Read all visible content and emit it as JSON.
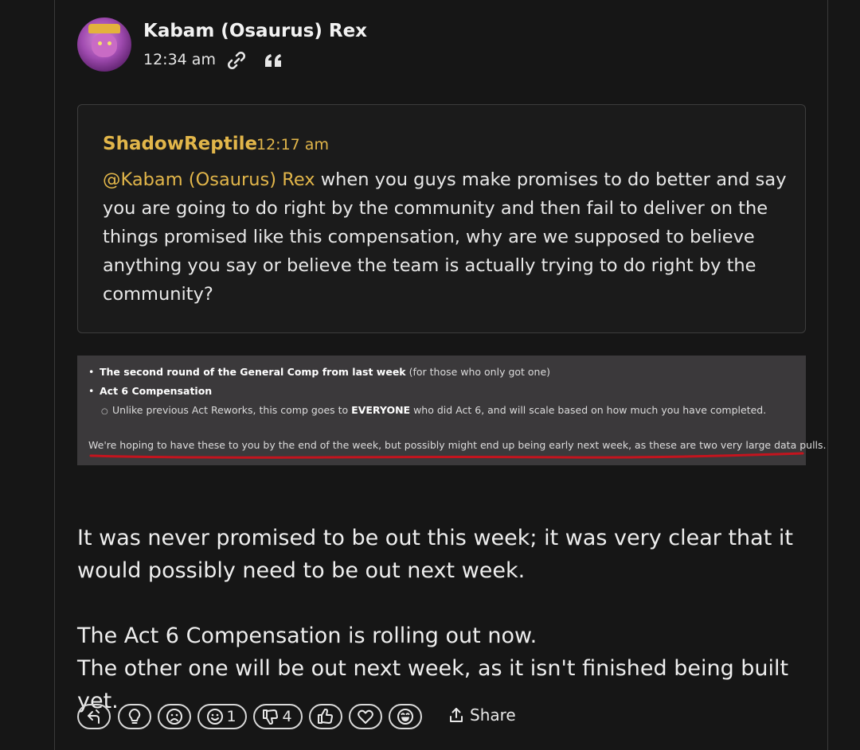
{
  "post": {
    "author": "Kabam (Osaurus) Rex",
    "time": "12:34 am",
    "icons": [
      "link-icon",
      "quote-icon"
    ]
  },
  "quote": {
    "author": "ShadowReptile",
    "time": "12:17 am",
    "mention": "@Kabam (Osaurus) Rex",
    "text": " when you guys make promises to do better and say you are going to do right by the community and then fail to deliver on the things promised like this compensation, why are we supposed to believe anything you say or believe the team is actually trying to do right by the community?"
  },
  "embed": {
    "bullet1_bold": "The second round of the General Comp from last week",
    "bullet1_rest": " (for those who only got one)",
    "bullet2_bold": "Act 6 Compensation",
    "sub1_pre": "Unlike previous Act Reworks, this comp goes to ",
    "sub1_bold": "EVERYONE",
    "sub1_post": " who did Act 6, and will scale based on how much you have completed.",
    "note": "We're hoping to have these to you by the end of the week, but possibly might end up being early next week, as these are two very large data pulls.",
    "underline_color": "#c4141e"
  },
  "reply": {
    "para1": "It was never promised to be out this week; it was very clear that it would possibly need to be out next week.",
    "line2": "The Act 6 Compensation is rolling out now.",
    "line3": "The other one will be out next week, as it isn't finished being built yet."
  },
  "reactions": [
    {
      "icon": "reply-arrow-icon",
      "count": ""
    },
    {
      "icon": "lightbulb-icon",
      "count": ""
    },
    {
      "icon": "sad-face-icon",
      "count": ""
    },
    {
      "icon": "smile-face-icon",
      "count": "1"
    },
    {
      "icon": "thumbs-down-icon",
      "count": "4"
    },
    {
      "icon": "thumbs-up-icon",
      "count": ""
    },
    {
      "icon": "heart-icon",
      "count": ""
    },
    {
      "icon": "laugh-face-icon",
      "count": ""
    }
  ],
  "share_label": "Share",
  "colors": {
    "background": "#161616",
    "accent": "#e2b64a",
    "embed_bg": "#3b393b"
  }
}
